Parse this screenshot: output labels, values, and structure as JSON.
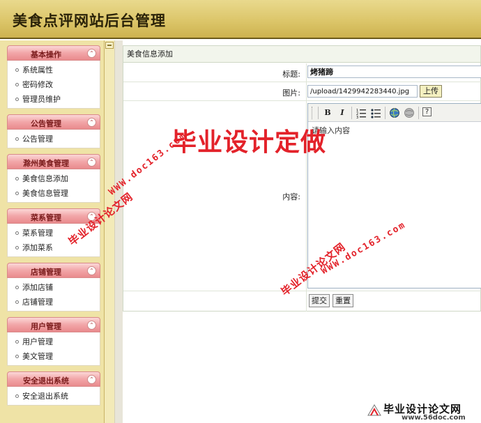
{
  "header": {
    "title": "美食点评网站后台管理"
  },
  "sidebar": {
    "groups": [
      {
        "title": "基本操作",
        "items": [
          "系统属性",
          "密码修改",
          "管理员维护"
        ]
      },
      {
        "title": "公告管理",
        "items": [
          "公告管理"
        ]
      },
      {
        "title": "滁州美食管理",
        "items": [
          "美食信息添加",
          "美食信息管理"
        ]
      },
      {
        "title": "菜系管理",
        "items": [
          "菜系管理",
          "添加菜系"
        ]
      },
      {
        "title": "店铺管理",
        "items": [
          "添加店铺",
          "店铺管理"
        ]
      },
      {
        "title": "用户管理",
        "items": [
          "用户管理",
          "美文管理"
        ]
      },
      {
        "title": "安全退出系统",
        "items": [
          "安全退出系统"
        ]
      }
    ],
    "toggle_glyph": "⌃"
  },
  "form": {
    "caption": "美食信息添加",
    "title_label": "标题:",
    "title_value": "烤猪蹄",
    "image_label": "图片:",
    "image_value": "/upload/1429942283440.jpg",
    "upload_label": "上传",
    "content_label": "内容:",
    "editor_placeholder": "请输入内容",
    "editor_tools": [
      "bold-button",
      "italic-button",
      "ordered-list-button",
      "unordered-list-button",
      "link-button",
      "unlink-button",
      "help-button"
    ],
    "submit_label": "提交",
    "reset_label": "重置"
  },
  "watermarks": {
    "big": "毕业设计定做",
    "url": "WWW.doc163.com",
    "cn": "毕业设计论文网"
  },
  "logo": {
    "text": "毕业设计论文网",
    "url": "www.56doc.com"
  },
  "colors": {
    "header_bg": "#dcc66a",
    "sidebar_bg": "#efe3a6",
    "group_head": "#f2a6a8",
    "watermark": "#e3222a"
  }
}
